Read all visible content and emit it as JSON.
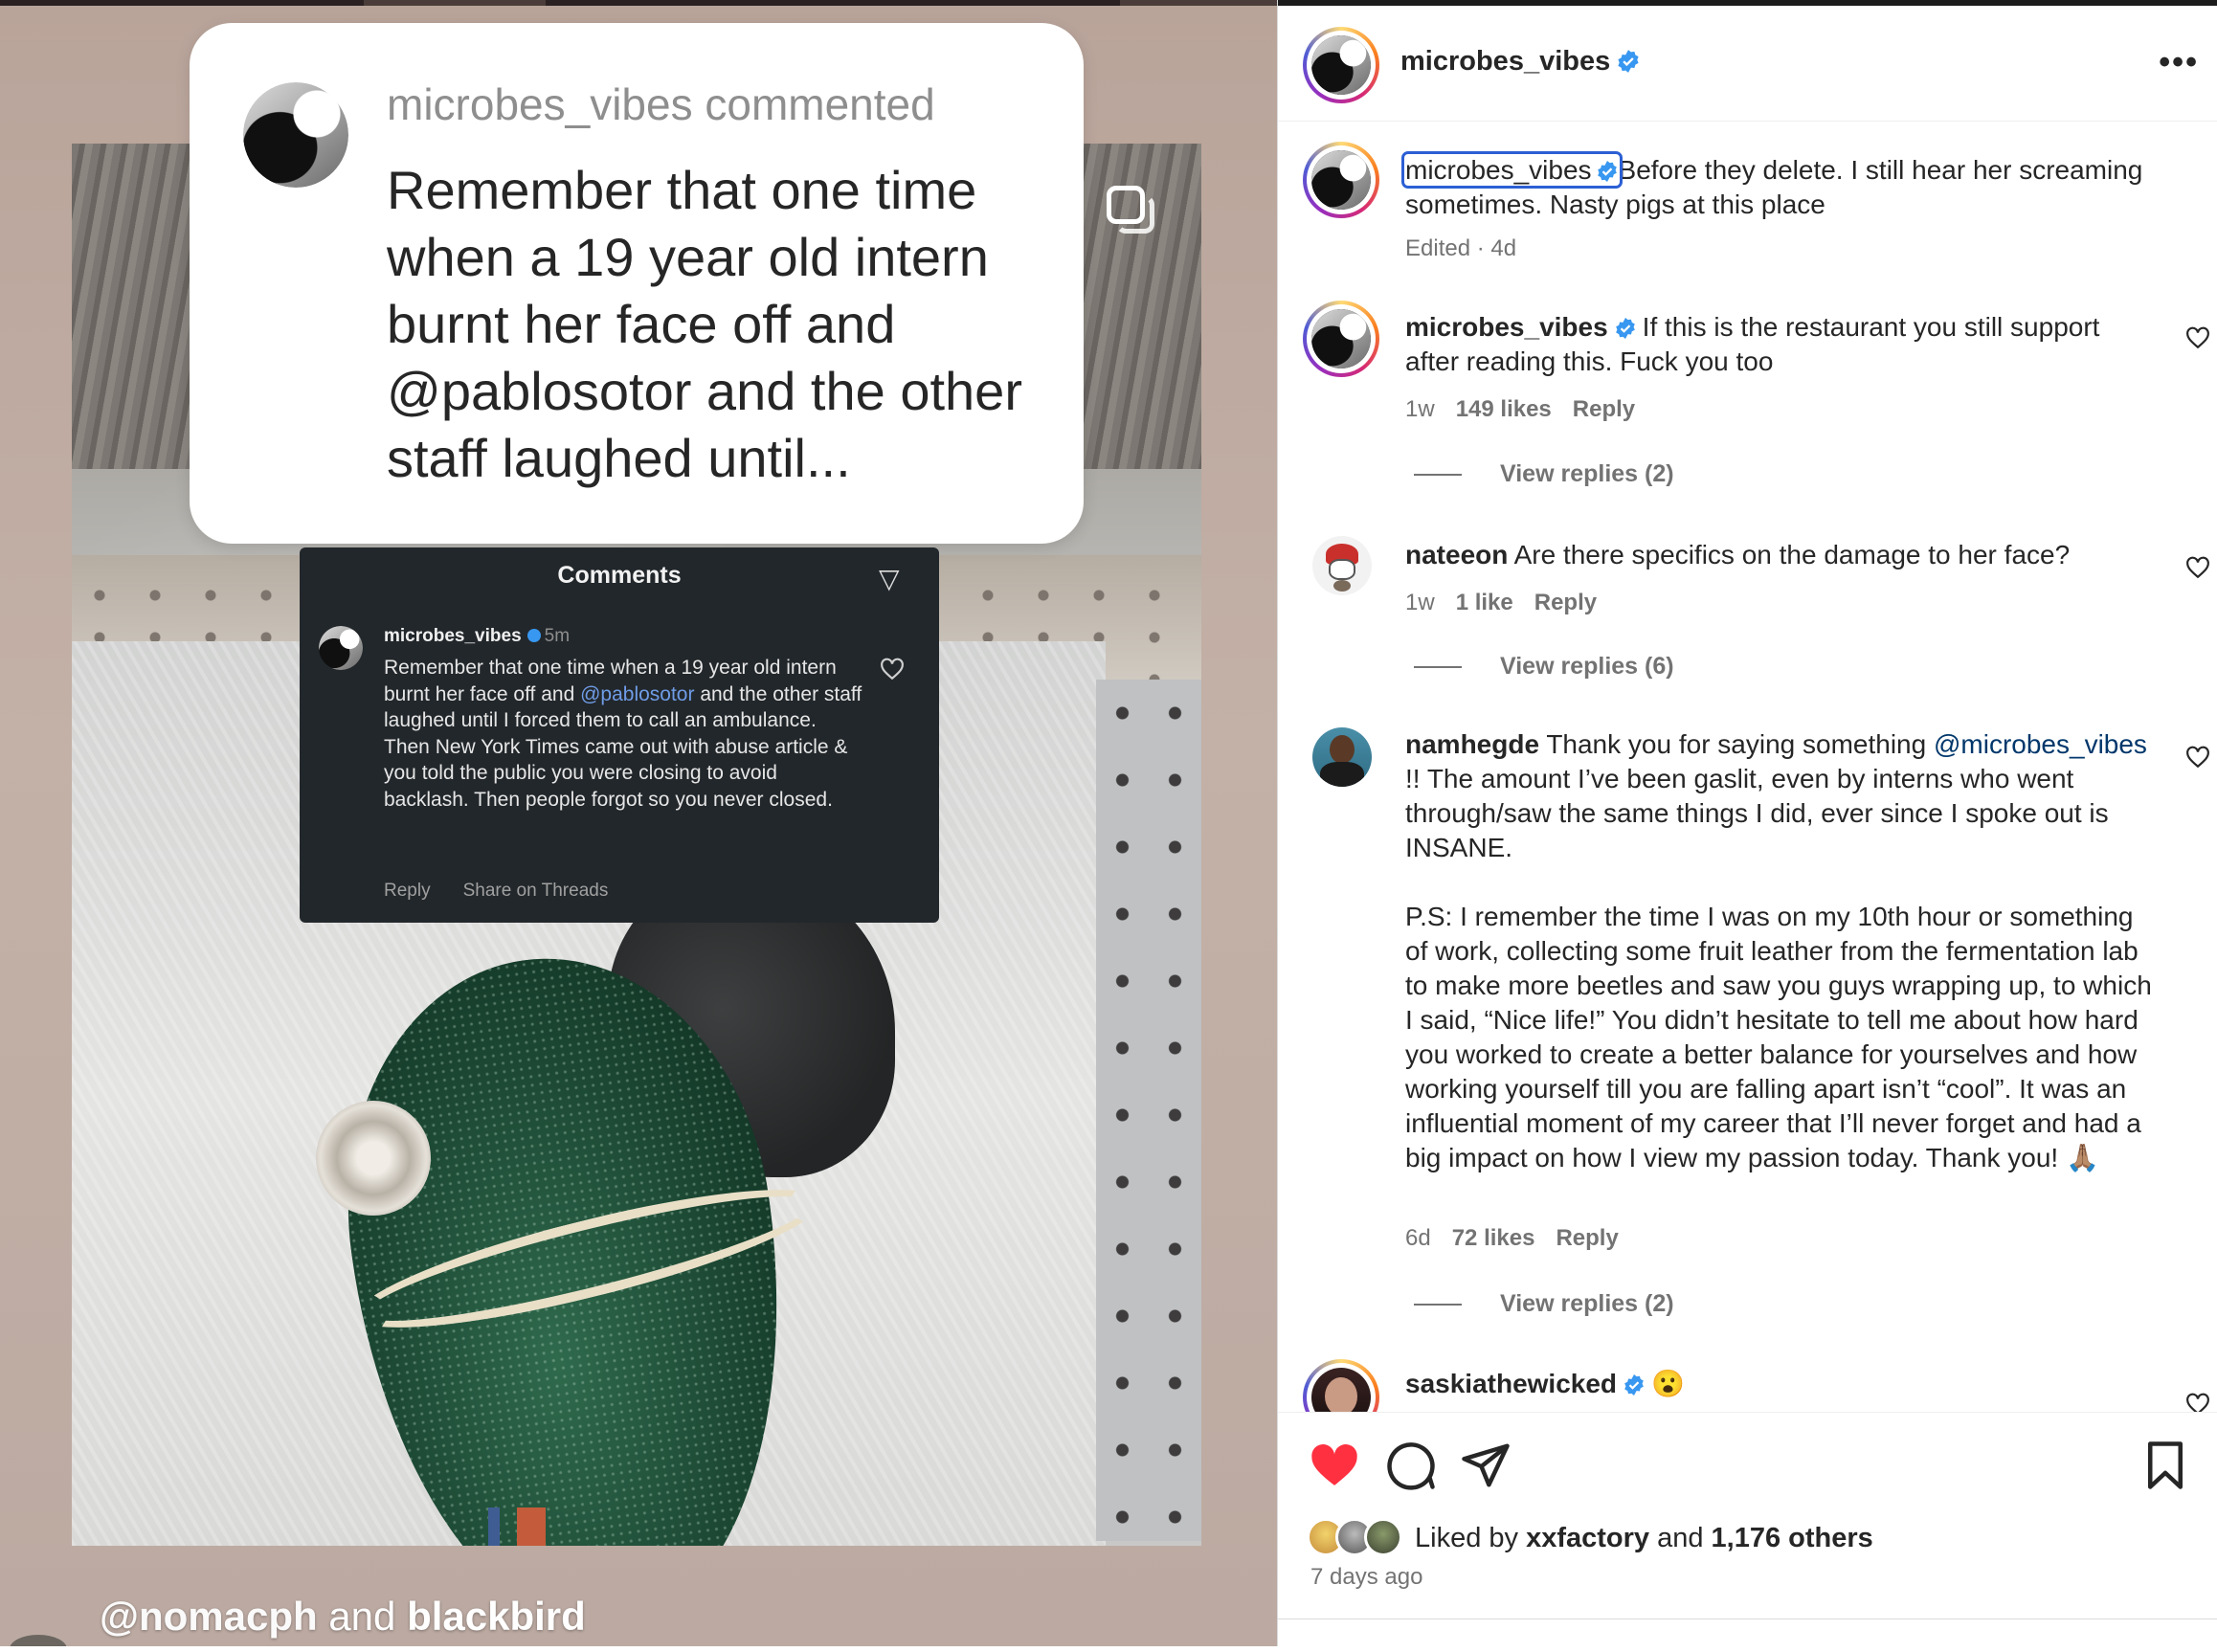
{
  "media": {
    "bubble": {
      "username_line": "microbes_vibes commented",
      "text": "Remember that one time when a 19 year old intern burnt her face off and @pablosotor and the other staff laughed until..."
    },
    "screenshot": {
      "title": "Comments",
      "username": "microbes_vibes",
      "time": "5m",
      "text_before_mention": "Remember that one time when a 19 year old intern burnt her face off and ",
      "mention": "@pablosotor",
      "text_after_mention": " and the other staff laughed until I forced them to call an ambulance. Then New York Times came out with abuse article & you told the public you were closing to avoid backlash. Then people forgot so you never closed.",
      "reply_label": "Reply",
      "share_label": "Share on Threads"
    },
    "tag_handle": "@nomacph",
    "tag_and": " and ",
    "tag_other": "blackbird"
  },
  "post": {
    "author": "microbes_vibes",
    "more_icon": "more-icon",
    "caption": {
      "username": "microbes_vibes",
      "text": "Before they delete. I still hear her screaming sometimes. Nasty pigs at this place",
      "meta": "Edited · 4d"
    },
    "comments": [
      {
        "username": "microbes_vibes",
        "text": "If this is the restaurant you still support after reading this. Fuck you too",
        "time": "1w",
        "likes": "149 likes",
        "reply": "Reply",
        "view_replies": "View replies (2)"
      },
      {
        "username": "nateeon",
        "text": "Are there specifics on the damage to her face?",
        "time": "1w",
        "likes": "1 like",
        "reply": "Reply",
        "view_replies": "View replies (6)"
      },
      {
        "username": "namhegde",
        "text_pre": "Thank you for saying something ",
        "mention": "@microbes_vibes",
        "text_post": " !! The amount I’ve been gaslit, even by interns who went through/saw the same things I did, ever since I spoke out is INSANE.",
        "text_ps": "P.S: I remember the time I was on my 10th hour or something of work, collecting some fruit leather from the fermentation lab to make more beetles and saw you guys wrapping up, to which I said, “Nice life!” You didn’t hesitate to tell me about how hard you worked to create a better balance for yourselves and how working yourself till you are falling apart isn’t “cool”. It was an influential moment of my career that I’ll never forget and had a big impact on how I view my passion today. Thank you! 🙏🏽",
        "time": "6d",
        "likes": "72 likes",
        "reply": "Reply",
        "view_replies": "View replies (2)"
      },
      {
        "username": "saskiathewicked",
        "text": "😮"
      }
    ],
    "likes": {
      "prefix": "Liked by ",
      "user": "xxfactory",
      "middle": " and ",
      "others": "1,176 others"
    },
    "time_ago": "7 days ago"
  },
  "colors": {
    "like_red": "#ff3040",
    "verified_blue": "#3897f0",
    "link_blue": "#00376b"
  }
}
